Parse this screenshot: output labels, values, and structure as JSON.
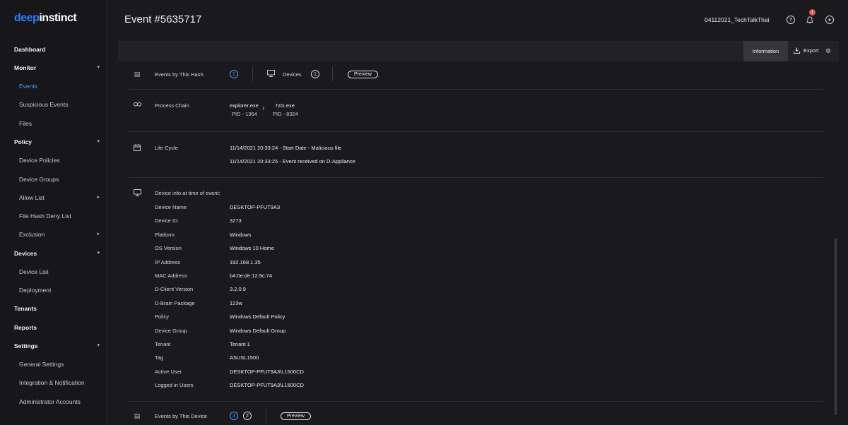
{
  "logo": {
    "part1": "deep",
    "part2": "instinct"
  },
  "sidebar": {
    "items": [
      {
        "label": "Dashboard",
        "type": "section"
      },
      {
        "label": "Monitor",
        "type": "section",
        "caret": "▾"
      },
      {
        "label": "Events",
        "type": "sub",
        "active": true
      },
      {
        "label": "Suspicious Events",
        "type": "sub"
      },
      {
        "label": "Files",
        "type": "sub"
      },
      {
        "label": "Policy",
        "type": "section",
        "caret": "▾"
      },
      {
        "label": "Device Policies",
        "type": "sub"
      },
      {
        "label": "Device Groups",
        "type": "sub"
      },
      {
        "label": "Allow List",
        "type": "sub",
        "caret": "▸"
      },
      {
        "label": "File Hash Deny List",
        "type": "sub"
      },
      {
        "label": "Exclusion",
        "type": "sub",
        "caret": "▸"
      },
      {
        "label": "Devices",
        "type": "section",
        "caret": "▾"
      },
      {
        "label": "Device List",
        "type": "sub"
      },
      {
        "label": "Deployment",
        "type": "sub"
      },
      {
        "label": "Tenants",
        "type": "section"
      },
      {
        "label": "Reports",
        "type": "section"
      },
      {
        "label": "Settings",
        "type": "section",
        "caret": "▾"
      },
      {
        "label": "General Settings",
        "type": "sub"
      },
      {
        "label": "Integration & Notification",
        "type": "sub"
      },
      {
        "label": "Administrator Accounts",
        "type": "sub"
      }
    ]
  },
  "header": {
    "title": "Event #5635717",
    "user": "04112021_TechTalkThai",
    "notification_count": "1"
  },
  "toolbar": {
    "information_tab": "Information",
    "export_label": "Export"
  },
  "hash_row": {
    "label": "Events by This Hash",
    "hash_count": "1",
    "devices_label": "Devices",
    "devices_count": "1",
    "preview": "Preview"
  },
  "process_chain": {
    "label": "Process Chain",
    "parent_name": "explorer.exe",
    "parent_pid": "PID - 1364",
    "child_name": "7zG.exe",
    "child_pid": "PID - 8324"
  },
  "life_cycle": {
    "label": "Life Cycle",
    "events": [
      "11/14/2021 20:33:24 - Start Date - Malicious file",
      "11/14/2021 20:33:25 - Event received on D-Appliance"
    ]
  },
  "device_info": {
    "heading": "Device info at time of event:",
    "fields": [
      {
        "label": "Device Name",
        "value": "DESKTOP-PFUT9A3"
      },
      {
        "label": "Device ID",
        "value": "3273"
      },
      {
        "label": "Platform",
        "value": "Windows"
      },
      {
        "label": "OS Version",
        "value": "Windows 10 Home"
      },
      {
        "label": "IP Address",
        "value": "192.168.1.35"
      },
      {
        "label": "MAC Address",
        "value": "b4:0e:de:12:9c:74"
      },
      {
        "label": "D-Client Version",
        "value": "3.2.0.9"
      },
      {
        "label": "D-Brain Package",
        "value": "123w"
      },
      {
        "label": "Policy",
        "value": "Windows Default Policy"
      },
      {
        "label": "Device Group",
        "value": "Windows Default Group"
      },
      {
        "label": "Tenant",
        "value": "Tenant 1"
      },
      {
        "label": "Tag",
        "value": "ASUSL1500"
      },
      {
        "label": "Active User",
        "value": "DESKTOP-PFUT9A3\\L1500CD"
      },
      {
        "label": "Logged in Users",
        "value": "DESKTOP-PFUT9A3\\L1500CD"
      }
    ]
  },
  "device_row": {
    "label": "Events by This Device",
    "count_blue": "3",
    "count_white": "2",
    "preview": "Preview"
  },
  "icons": {
    "list": "list-icon",
    "monitor": "monitor-icon",
    "link": "link-icon",
    "calendar": "calendar-icon",
    "chevron": "chevron-right-icon",
    "help": "help-icon",
    "bell": "bell-icon",
    "user": "user-icon",
    "download": "download-icon",
    "gear": "gear-icon"
  },
  "colors": {
    "accent": "#2e7dff",
    "active_link": "#4a9bff",
    "badge": "#e05a5a"
  }
}
